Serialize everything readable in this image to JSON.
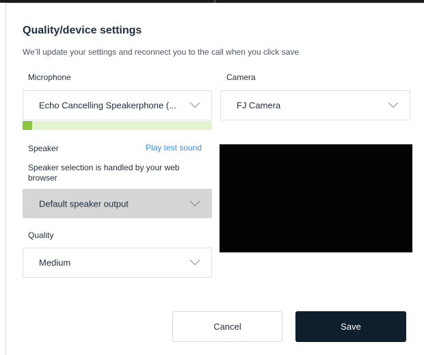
{
  "dialog": {
    "title": "Quality/device settings",
    "subtitle": "We’ll update your settings and reconnect you to the call when you click save"
  },
  "microphone": {
    "label": "Microphone",
    "value": "Echo Cancelling Speakerphone (...",
    "level": 0.05
  },
  "camera": {
    "label": "Camera",
    "value": "FJ Camera"
  },
  "speaker": {
    "label": "Speaker",
    "test_link": "Play test sound",
    "help": "Speaker selection is handled by your web browser",
    "value": "Default speaker output"
  },
  "quality": {
    "label": "Quality",
    "value": "Medium"
  },
  "actions": {
    "cancel": "Cancel",
    "save": "Save"
  },
  "colors": {
    "primary_button": "#0f1f2e",
    "link": "#3b8ce6",
    "meter_fill": "#8cc63f",
    "meter_track": "#e3f3cf"
  },
  "icons": {
    "select_indicator": "chevron-down-icon"
  }
}
